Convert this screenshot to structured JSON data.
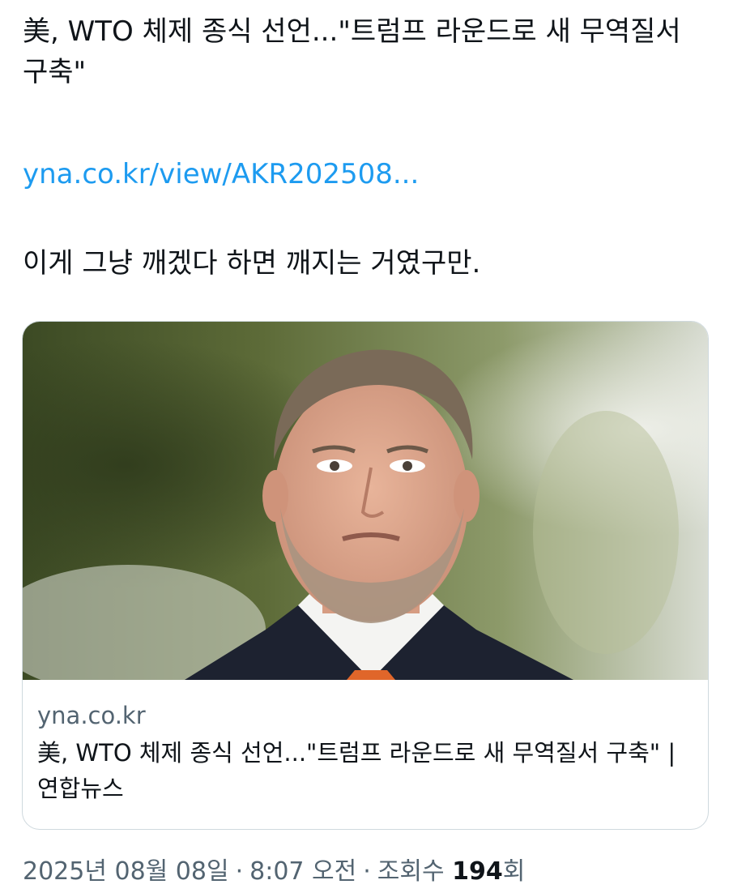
{
  "tweet": {
    "text": "美, WTO 체제 종식 선언...\"트럼프 라운드로 새 무역질서 구축\"",
    "link": "yna.co.kr/view/AKR202508...",
    "comment": "이게 그냥 깨겠다 하면 깨지는 거였구만."
  },
  "card": {
    "domain": "yna.co.kr",
    "title": "美, WTO 체제 종식 선언...\"트럼프 라운드로 새 무역질서 구축\" | 연합뉴스"
  },
  "meta": {
    "date": "2025년 08월 08일",
    "time": "8:07 오전",
    "views_label": "조회수",
    "views_count": "194",
    "views_suffix": "회"
  },
  "colors": {
    "link": "#1d9bf0",
    "secondary_text": "#536471",
    "border": "#cfd9de"
  }
}
